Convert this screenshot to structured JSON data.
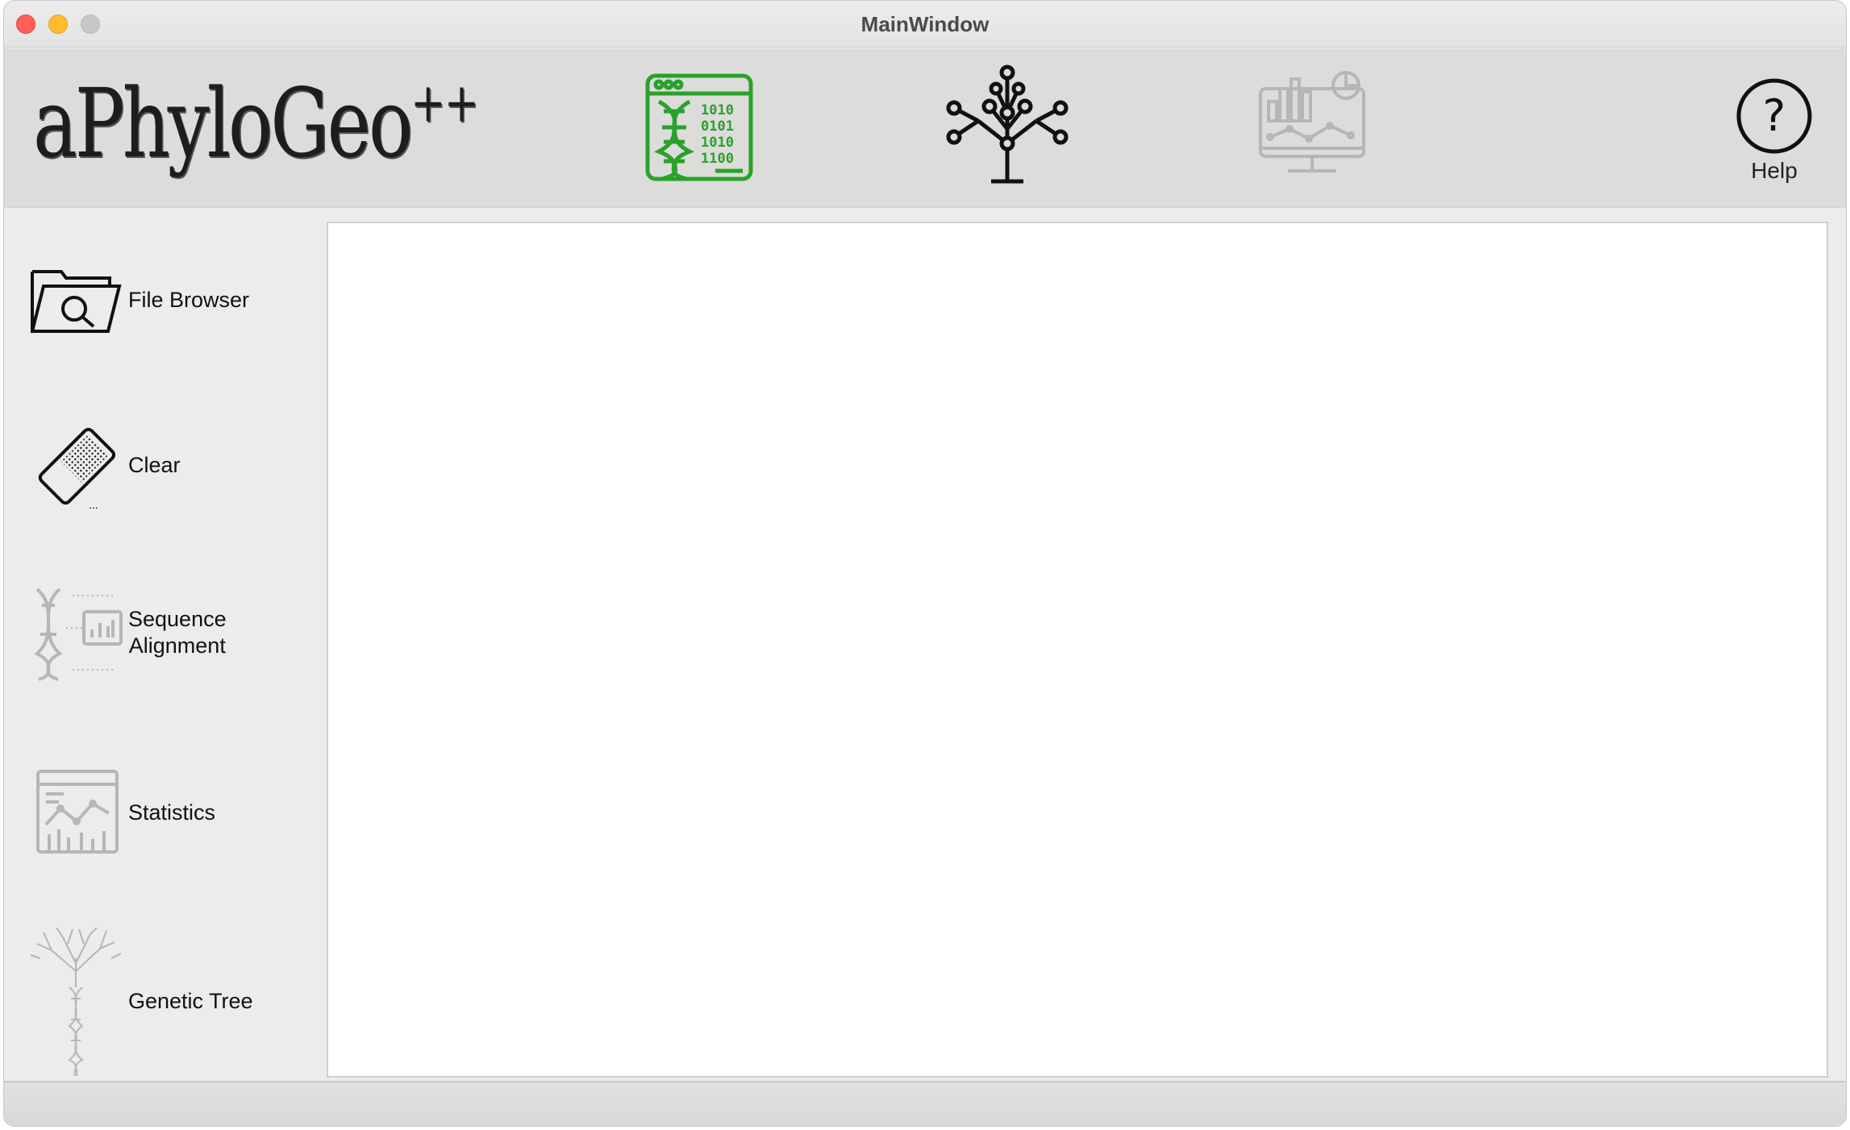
{
  "window": {
    "title": "MainWindow"
  },
  "toolbar": {
    "logo_text": "aPhyloGeo",
    "logo_superscript": "++",
    "help_label": "Help",
    "active_color": "#2aa12a",
    "inactive_color": "#b6b6b6"
  },
  "sidebar": {
    "items": [
      {
        "label": "File Browser",
        "icon": "folder-search-icon"
      },
      {
        "label": "Clear",
        "icon": "eraser-icon"
      },
      {
        "label_line1": "Sequence",
        "label_line2": "Alignment",
        "icon": "dna-chart-icon"
      },
      {
        "label": "Statistics",
        "icon": "statistics-dashboard-icon"
      },
      {
        "label": "Genetic Tree",
        "icon": "dna-tree-icon"
      }
    ]
  }
}
